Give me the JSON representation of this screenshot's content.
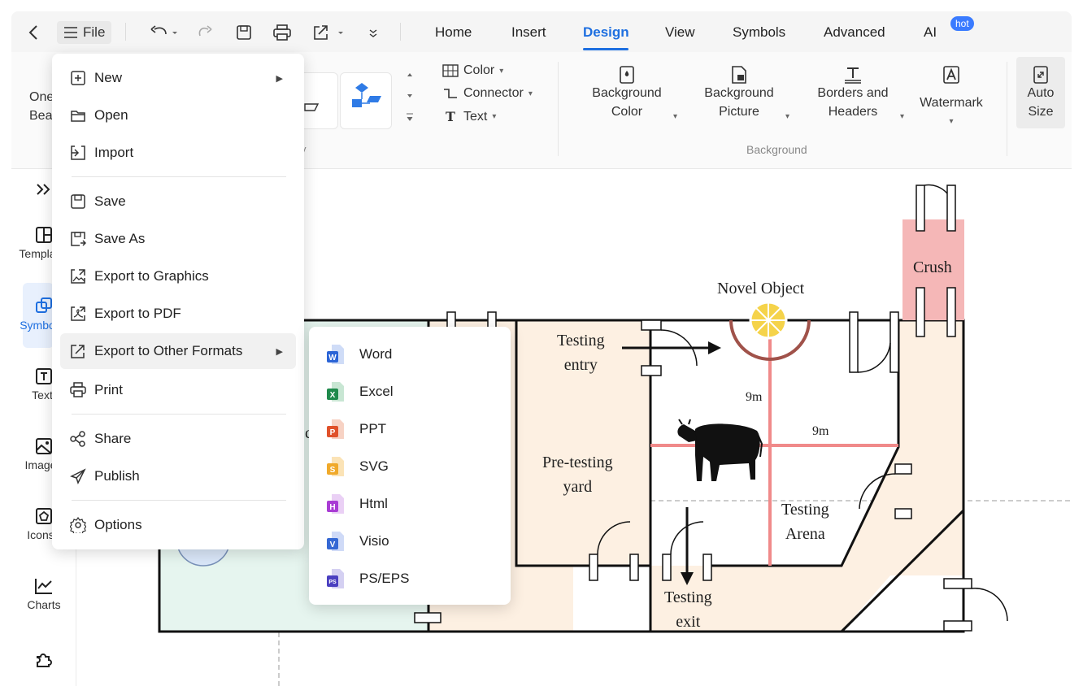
{
  "toolbar": {
    "file_label": "File",
    "tabs": [
      "Home",
      "Insert",
      "Design",
      "View",
      "Symbols",
      "Advanced",
      "AI"
    ],
    "active_tab": "Design",
    "hot_badge": "hot"
  },
  "ribbon": {
    "one_click_line1": "One",
    "one_click_line2": "Bea",
    "color_label": "Color",
    "connector_label": "Connector",
    "text_label": "Text",
    "background_color": [
      "Background",
      "Color"
    ],
    "background_picture": [
      "Background",
      "Picture"
    ],
    "borders_headers": [
      "Borders and",
      "Headers"
    ],
    "watermark": "Watermark",
    "auto_size": [
      "Auto",
      "Size"
    ],
    "group_background": "Background"
  },
  "sidebar": {
    "items": [
      "Templa",
      "Symbo",
      "Text",
      "Image",
      "Icons",
      "Charts"
    ]
  },
  "file_menu": {
    "items": [
      {
        "label": "New",
        "icon": "plus-square-icon"
      },
      {
        "label": "Open",
        "icon": "folder-icon"
      },
      {
        "label": "Import",
        "icon": "import-icon"
      },
      {
        "label": "Save",
        "icon": "save-icon"
      },
      {
        "label": "Save As",
        "icon": "save-as-icon"
      },
      {
        "label": "Export to Graphics",
        "icon": "image-export-icon"
      },
      {
        "label": "Export to PDF",
        "icon": "pdf-export-icon"
      },
      {
        "label": "Export to Other Formats",
        "icon": "export-icon"
      },
      {
        "label": "Print",
        "icon": "print-icon"
      },
      {
        "label": "Share",
        "icon": "share-icon"
      },
      {
        "label": "Publish",
        "icon": "publish-icon"
      },
      {
        "label": "Options",
        "icon": "gear-icon"
      }
    ]
  },
  "export_submenu": {
    "items": [
      {
        "label": "Word",
        "color": "#2b64d6",
        "letter": "W"
      },
      {
        "label": "Excel",
        "color": "#1f8a4c",
        "letter": "X"
      },
      {
        "label": "PPT",
        "color": "#e0512a",
        "letter": "P"
      },
      {
        "label": "SVG",
        "color": "#f0a92a",
        "letter": "S"
      },
      {
        "label": "Html",
        "color": "#a93cd4",
        "letter": "H"
      },
      {
        "label": "Visio",
        "color": "#3568d4",
        "letter": "V"
      },
      {
        "label": "PS/EPS",
        "color": "#4a3fc0",
        "letter": "PS"
      }
    ]
  },
  "diagram": {
    "crush": "Crush",
    "novel_object": "Novel Object",
    "testing_entry": [
      "Testing",
      "entry"
    ],
    "distance_vertical": "9m",
    "distance_horizontal": "9m",
    "pre_testing_yard": [
      "Pre-testing",
      "yard"
    ],
    "testing_arena": [
      "Testing",
      "Arena"
    ],
    "testing_exit": [
      "Testing",
      "exit"
    ],
    "partial_label": "c"
  }
}
